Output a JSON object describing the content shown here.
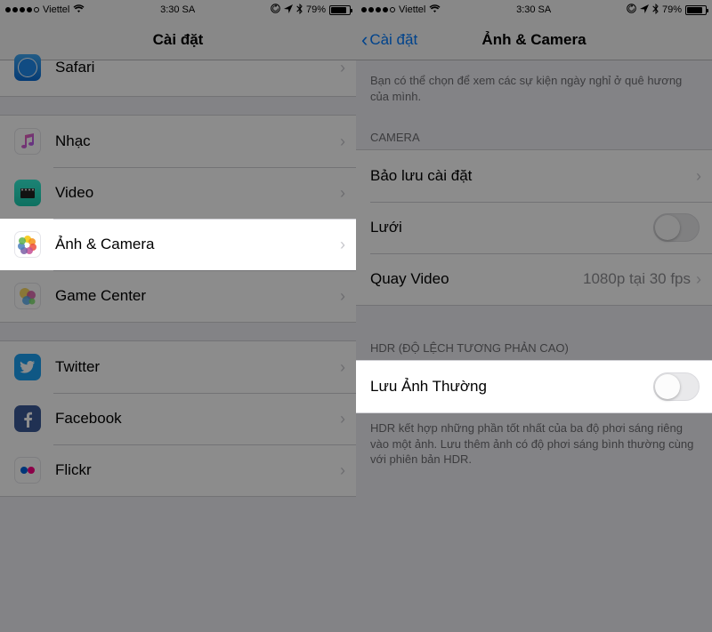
{
  "statusbar": {
    "carrier": "Viettel",
    "time": "3:30 SA",
    "battery_pct": "79%"
  },
  "left": {
    "title": "Cài đặt",
    "rows": {
      "safari": "Safari",
      "music": "Nhạc",
      "video": "Video",
      "photos": "Ảnh & Camera",
      "gamecenter": "Game Center",
      "twitter": "Twitter",
      "facebook": "Facebook",
      "flickr": "Flickr"
    }
  },
  "right": {
    "back": "Cài đặt",
    "title": "Ảnh & Camera",
    "holiday_footer": "Bạn có thể chọn để xem các sự kiện ngày nghỉ ở quê hương của mình.",
    "camera_header": "CAMERA",
    "preserve": "Bảo lưu cài đặt",
    "grid": "Lưới",
    "record": "Quay Video",
    "record_value": "1080p tại 30 fps",
    "hdr_header": "HDR (ĐỘ LỆCH TƯƠNG PHẢN CAO)",
    "keep_normal": "Lưu Ảnh Thường",
    "hdr_footer": "HDR kết hợp những phần tốt nhất của ba độ phơi sáng riêng vào một ảnh. Lưu thêm ảnh có độ phơi sáng bình thường cùng với phiên bản HDR."
  }
}
